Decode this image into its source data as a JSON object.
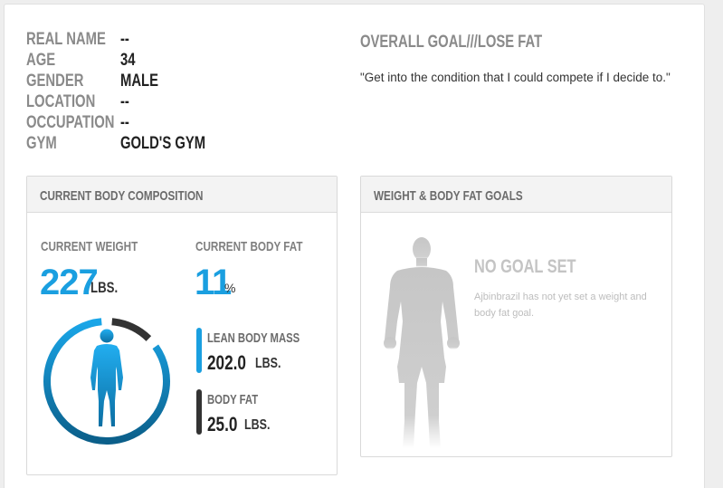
{
  "profile": {
    "rows": [
      {
        "label": "REAL NAME",
        "value": "--"
      },
      {
        "label": "AGE",
        "value": "34"
      },
      {
        "label": "GENDER",
        "value": "MALE"
      },
      {
        "label": "LOCATION",
        "value": "--"
      },
      {
        "label": "OCCUPATION",
        "value": "--"
      },
      {
        "label": "GYM",
        "value": "GOLD'S GYM"
      }
    ]
  },
  "goal": {
    "title": "OVERALL GOAL///LOSE FAT",
    "quote": "\"Get into the condition that I could compete if I decide to.\""
  },
  "composition": {
    "title": "CURRENT BODY COMPOSITION",
    "weight_label": "CURRENT WEIGHT",
    "weight_value": "227",
    "weight_unit": "LBS.",
    "bodyfat_label": "CURRENT BODY FAT",
    "bodyfat_value": "11",
    "bodyfat_unit": "%",
    "lean_label": "LEAN BODY MASS",
    "lean_value": "202.0",
    "lean_unit": "LBS.",
    "fat_label": "BODY FAT",
    "fat_value": "25.0",
    "fat_unit": "LBS.",
    "lean_fraction": 0.89,
    "colors": {
      "accent": "#1a9fe0",
      "dark_blue": "#0b5f8a",
      "fat": "#333333"
    },
    "icon": "body-figure-icon"
  },
  "goals_panel": {
    "title": "WEIGHT & BODY FAT GOALS",
    "nogoal_title": "NO GOAL SET",
    "nogoal_text": "Ajbinbrazil has not yet set a weight and body fat goal.",
    "icon": "bodybuilder-silhouette-icon"
  }
}
